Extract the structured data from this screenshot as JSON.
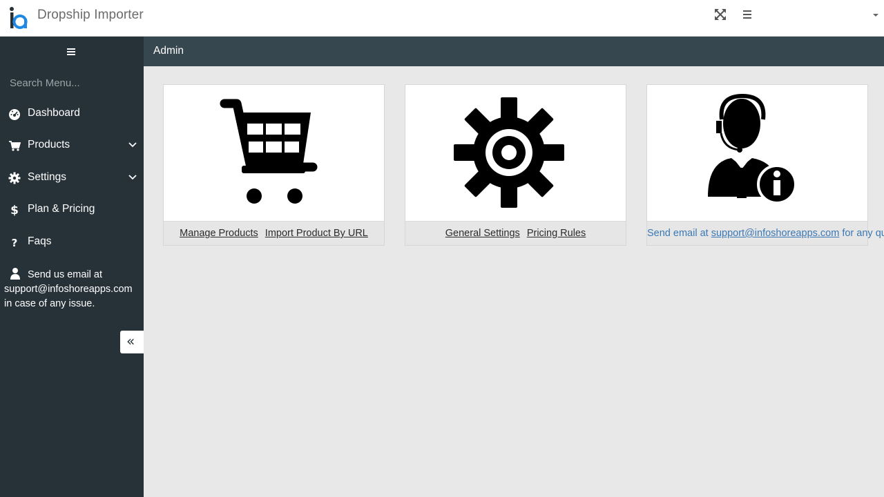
{
  "header": {
    "app_title": "Dropship Importer"
  },
  "sidebar": {
    "search_placeholder": "Search Menu...",
    "items": [
      {
        "label": "Dashboard",
        "icon": "dashboard-icon"
      },
      {
        "label": "Products",
        "icon": "cart-icon",
        "expandable": true
      },
      {
        "label": "Settings",
        "icon": "gear-icon",
        "expandable": true
      },
      {
        "label": "Plan & Pricing",
        "icon": "dollar-icon"
      },
      {
        "label": "Faqs",
        "icon": "question-icon"
      }
    ],
    "support_text": "Send us email at support@infoshoreapps.com in case of any issue."
  },
  "breadcrumb": {
    "current": "Admin"
  },
  "cards": {
    "products": {
      "icon": "shopping-cart-icon",
      "link1": "Manage Products",
      "link2": "Import Product By URL"
    },
    "settings": {
      "icon": "settings-gear-icon",
      "link1": "General Settings",
      "link2": "Pricing Rules"
    },
    "support": {
      "icon": "support-agent-info-icon",
      "prefix": "Send email at",
      "email": "support@infoshoreapps.com",
      "suffix": "for any query"
    }
  },
  "colors": {
    "sidebar_bg": "#263238",
    "crumbbar_bg": "#37474f",
    "content_bg": "#e8e8e8",
    "link_blue": "#3a78b5",
    "logo_blue": "#1e88e5"
  }
}
